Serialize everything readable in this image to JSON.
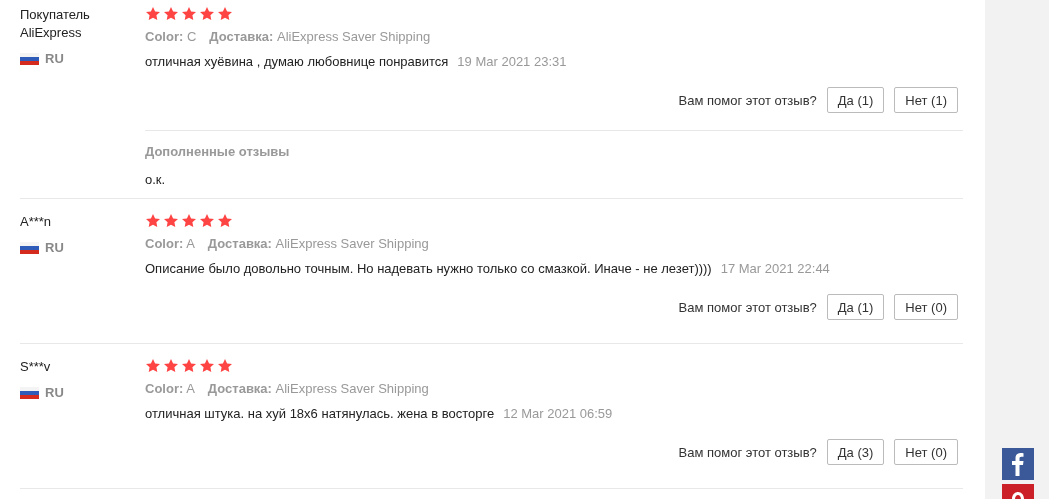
{
  "reviews": [
    {
      "name": "Покупатель AliExpress",
      "country": "RU",
      "stars": 5,
      "color_label": "Color:",
      "color_value": "C",
      "shipping_label": "Доставка:",
      "shipping_value": "AliExpress Saver Shipping",
      "text": "отличная хуёвина , думаю любовнице понравится",
      "date": "19 Mar 2021 23:31",
      "helpful_question": "Вам помог этот отзыв?",
      "yes": "Да (1)",
      "no": "Нет (1)",
      "additional": {
        "title": "Дополненные отзывы",
        "text": "о.к."
      }
    },
    {
      "name": "A***n",
      "country": "RU",
      "stars": 5,
      "color_label": "Color:",
      "color_value": "A",
      "shipping_label": "Доставка:",
      "shipping_value": "AliExpress Saver Shipping",
      "text": "Описание было довольно точным. Но надевать нужно только со смазкой. Иначе - не лезет))))",
      "date": "17 Mar 2021 22:44",
      "helpful_question": "Вам помог этот отзыв?",
      "yes": "Да (1)",
      "no": "Нет (0)"
    },
    {
      "name": "S***v",
      "country": "RU",
      "stars": 5,
      "color_label": "Color:",
      "color_value": "A",
      "shipping_label": "Доставка:",
      "shipping_value": "AliExpress Saver Shipping",
      "text": "отличная штука. на хуй 18х6 натянулась. жена в восторге",
      "date": "12 Mar 2021 06:59",
      "helpful_question": "Вам помог этот отзыв?",
      "yes": "Да (3)",
      "no": "Нет (0)"
    }
  ]
}
